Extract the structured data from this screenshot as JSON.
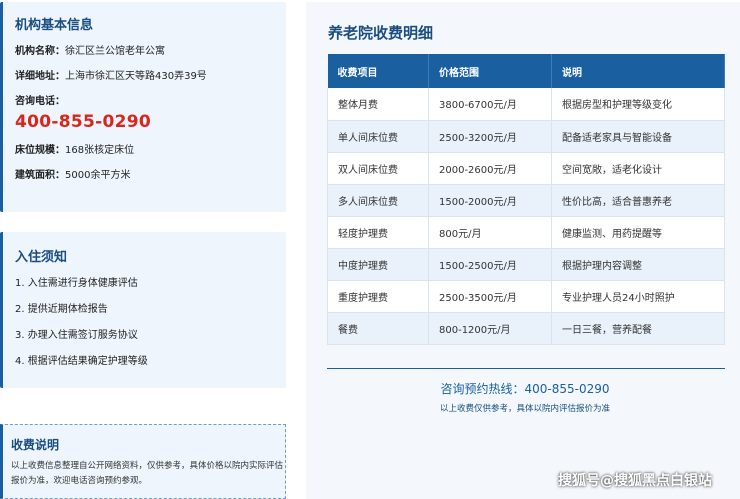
{
  "info": {
    "title": "机构基本信息",
    "name_label": "机构名称：",
    "name": "徐汇区兰公馆老年公寓",
    "address_label": "详细地址：",
    "address": "上海市徐汇区天等路430弄39号",
    "phone_label": "咨询电话：",
    "phone": "400-855-0290",
    "beds_label": "床位规模：",
    "beds": "168张核定床位",
    "area_label": "建筑面积：",
    "area": "5000余平方米"
  },
  "notice": {
    "title": "入住须知",
    "items": [
      "1. 入住需进行身体健康评估",
      "2. 提供近期体检报告",
      "3. 办理入住需签订服务协议",
      "4. 根据评估结果确定护理等级"
    ]
  },
  "fee_note": {
    "title": "收费说明",
    "text": "以上收费信息整理自公开网络资料，仅供参考，具体价格以院内实际评估报价为准，欢迎电话咨询预约参观。"
  },
  "main": {
    "title": "养老院收费明细",
    "columns": [
      "收费项目",
      "价格范围",
      "说明"
    ],
    "rows": [
      [
        "整体月费",
        "3800-6700元/月",
        "根据房型和护理等级变化"
      ],
      [
        "单人间床位费",
        "2500-3200元/月",
        "配备适老家具与智能设备"
      ],
      [
        "双人间床位费",
        "2000-2600元/月",
        "空间宽敞，适老化设计"
      ],
      [
        "多人间床位费",
        "1500-2000元/月",
        "性价比高，适合普惠养老"
      ],
      [
        "轻度护理费",
        "800元/月",
        "健康监测、用药提醒等"
      ],
      [
        "中度护理费",
        "1500-2500元/月",
        "根据护理内容调整"
      ],
      [
        "重度护理费",
        "2500-3500元/月",
        "专业护理人员24小时照护"
      ],
      [
        "餐费",
        "800-1200元/月",
        "一日三餐，营养配餐"
      ]
    ],
    "hotline": "咨询预约热线：400-855-0290",
    "footnote": "以上收费仅供参考，具体以院内评估报价为准"
  },
  "watermark": "搜狐号@搜狐黑点白银站",
  "colors": {
    "accent": "#1a5fa0",
    "phone": "#d8261c",
    "panel": "#eef5fc"
  }
}
